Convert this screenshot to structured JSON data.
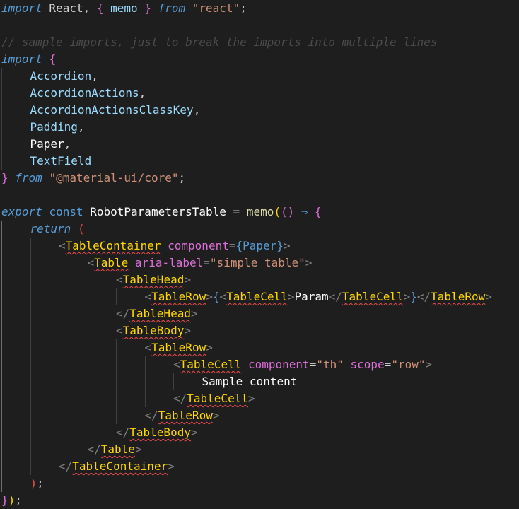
{
  "colors": {
    "background": "#1e1e1e",
    "keyword": "#569cd6",
    "keyword_control": "#c586c0",
    "identifier": "#9cdcfe",
    "plain": "#d4d4d4",
    "string": "#ce9178",
    "comment": "#6a9955",
    "tag": "#4ec9b0",
    "function": "#dcdcaa",
    "brace_gold": "#ffd700",
    "brace_pink": "#da70d6",
    "brace_blue": "#179fff",
    "bracket_tag": "#808080",
    "error_underline": "#f14c4c"
  },
  "code_lines": [
    {
      "indent": 0,
      "tokens": [
        {
          "t": "import",
          "c": "#569cd6",
          "i": true
        },
        {
          "t": " React, ",
          "c": "#d4d4d4"
        },
        {
          "t": "{",
          "c": "#da70d6"
        },
        {
          "t": " memo ",
          "c": "#9cdcfe"
        },
        {
          "t": "}",
          "c": "#da70d6"
        },
        {
          "t": " ",
          "c": "#d4d4d4"
        },
        {
          "t": "from",
          "c": "#569cd6",
          "i": true
        },
        {
          "t": " ",
          "c": "#d4d4d4"
        },
        {
          "t": "\"react\"",
          "c": "#ce9178"
        },
        {
          "t": ";",
          "c": "#d4d4d4"
        }
      ]
    },
    {
      "indent": 0,
      "tokens": []
    },
    {
      "indent": 0,
      "tokens": [
        {
          "t": "// sample imports, just to break the imports into multiple lines",
          "c": "#4b4b4b",
          "i": true
        }
      ]
    },
    {
      "indent": 0,
      "tokens": [
        {
          "t": "import",
          "c": "#569cd6",
          "i": true
        },
        {
          "t": " ",
          "c": "#d4d4d4"
        },
        {
          "t": "{",
          "c": "#da70d6"
        }
      ]
    },
    {
      "indent": 1,
      "tokens": [
        {
          "t": "Accordion",
          "c": "#9cdcfe"
        },
        {
          "t": ",",
          "c": "#d4d4d4"
        }
      ]
    },
    {
      "indent": 1,
      "tokens": [
        {
          "t": "AccordionActions",
          "c": "#9cdcfe"
        },
        {
          "t": ",",
          "c": "#d4d4d4"
        }
      ]
    },
    {
      "indent": 1,
      "tokens": [
        {
          "t": "AccordionActionsClassKey",
          "c": "#9cdcfe"
        },
        {
          "t": ",",
          "c": "#d4d4d4"
        }
      ]
    },
    {
      "indent": 1,
      "tokens": [
        {
          "t": "Padding",
          "c": "#9cdcfe"
        },
        {
          "t": ",",
          "c": "#d4d4d4"
        }
      ]
    },
    {
      "indent": 1,
      "tokens": [
        {
          "t": "Paper",
          "c": "#ffffff"
        },
        {
          "t": ",",
          "c": "#d4d4d4"
        }
      ]
    },
    {
      "indent": 1,
      "tokens": [
        {
          "t": "TextField",
          "c": "#9cdcfe"
        }
      ]
    },
    {
      "indent": 0,
      "tokens": [
        {
          "t": "}",
          "c": "#da70d6"
        },
        {
          "t": " ",
          "c": "#d4d4d4"
        },
        {
          "t": "from",
          "c": "#569cd6",
          "i": true
        },
        {
          "t": " ",
          "c": "#d4d4d4"
        },
        {
          "t": "\"@material-ui/core\"",
          "c": "#ce9178"
        },
        {
          "t": ";",
          "c": "#d4d4d4"
        }
      ]
    },
    {
      "indent": 0,
      "tokens": []
    },
    {
      "indent": 0,
      "tokens": [
        {
          "t": "export",
          "c": "#569cd6",
          "i": true
        },
        {
          "t": " ",
          "c": "#d4d4d4"
        },
        {
          "t": "const",
          "c": "#569cd6"
        },
        {
          "t": " RobotParametersTable ",
          "c": "#ffffff"
        },
        {
          "t": "=",
          "c": "#d4d4d4"
        },
        {
          "t": " ",
          "c": "#d4d4d4"
        },
        {
          "t": "memo",
          "c": "#dcdcaa"
        },
        {
          "t": "(",
          "c": "#ffd700"
        },
        {
          "t": "()",
          "c": "#da70d6"
        },
        {
          "t": " ",
          "c": "#d4d4d4"
        },
        {
          "t": "⇒",
          "c": "#569cd6"
        },
        {
          "t": " ",
          "c": "#d4d4d4"
        },
        {
          "t": "{",
          "c": "#da70d6"
        }
      ]
    },
    {
      "indent": 1,
      "tokens": [
        {
          "t": "return",
          "c": "#569cd6",
          "i": true
        },
        {
          "t": " ",
          "c": "#d4d4d4"
        },
        {
          "t": "(",
          "c": "#f14c4c"
        }
      ]
    },
    {
      "indent": 2,
      "tokens": [
        {
          "t": "<",
          "c": "#808080"
        },
        {
          "t": "TableContainer",
          "c": "#ffd700",
          "e": true
        },
        {
          "t": " ",
          "c": "#d4d4d4"
        },
        {
          "t": "component",
          "c": "#da70d6"
        },
        {
          "t": "=",
          "c": "#d4d4d4"
        },
        {
          "t": "{",
          "c": "#569cd6"
        },
        {
          "t": "Paper",
          "c": "#569cd6"
        },
        {
          "t": "}",
          "c": "#569cd6"
        },
        {
          "t": ">",
          "c": "#808080"
        }
      ]
    },
    {
      "indent": 3,
      "tokens": [
        {
          "t": "<",
          "c": "#808080"
        },
        {
          "t": "Table",
          "c": "#ffd700",
          "e": true
        },
        {
          "t": " ",
          "c": "#d4d4d4"
        },
        {
          "t": "aria-label",
          "c": "#da70d6"
        },
        {
          "t": "=",
          "c": "#d4d4d4"
        },
        {
          "t": "\"simple table\"",
          "c": "#ce9178"
        },
        {
          "t": ">",
          "c": "#808080"
        }
      ]
    },
    {
      "indent": 4,
      "tokens": [
        {
          "t": "<",
          "c": "#808080"
        },
        {
          "t": "TableHead",
          "c": "#ffd700",
          "e": true
        },
        {
          "t": ">",
          "c": "#808080"
        }
      ]
    },
    {
      "indent": 5,
      "tokens": [
        {
          "t": "<",
          "c": "#808080"
        },
        {
          "t": "TableRow",
          "c": "#ffd700",
          "e": true
        },
        {
          "t": ">",
          "c": "#808080"
        },
        {
          "t": "{",
          "c": "#569cd6"
        },
        {
          "t": "<",
          "c": "#808080"
        },
        {
          "t": "TableCell",
          "c": "#ffd700",
          "e": true
        },
        {
          "t": ">",
          "c": "#808080"
        },
        {
          "t": "Param",
          "c": "#ffffff"
        },
        {
          "t": "</",
          "c": "#808080"
        },
        {
          "t": "TableCell",
          "c": "#ffd700",
          "e": true
        },
        {
          "t": ">",
          "c": "#808080"
        },
        {
          "t": "}",
          "c": "#569cd6"
        },
        {
          "t": "</",
          "c": "#808080"
        },
        {
          "t": "TableRow",
          "c": "#ffd700",
          "e": true
        },
        {
          "t": ">",
          "c": "#808080"
        }
      ]
    },
    {
      "indent": 4,
      "tokens": [
        {
          "t": "</",
          "c": "#808080"
        },
        {
          "t": "TableHead",
          "c": "#ffd700",
          "e": true
        },
        {
          "t": ">",
          "c": "#808080"
        }
      ]
    },
    {
      "indent": 4,
      "tokens": [
        {
          "t": "<",
          "c": "#808080"
        },
        {
          "t": "TableBody",
          "c": "#ffd700",
          "e": true
        },
        {
          "t": ">",
          "c": "#808080"
        }
      ]
    },
    {
      "indent": 5,
      "tokens": [
        {
          "t": "<",
          "c": "#808080"
        },
        {
          "t": "TableRow",
          "c": "#ffd700",
          "e": true
        },
        {
          "t": ">",
          "c": "#808080"
        }
      ]
    },
    {
      "indent": 6,
      "tokens": [
        {
          "t": "<",
          "c": "#808080"
        },
        {
          "t": "TableCell",
          "c": "#ffd700",
          "e": true
        },
        {
          "t": " ",
          "c": "#d4d4d4"
        },
        {
          "t": "component",
          "c": "#da70d6"
        },
        {
          "t": "=",
          "c": "#d4d4d4"
        },
        {
          "t": "\"th\"",
          "c": "#ce9178"
        },
        {
          "t": " ",
          "c": "#d4d4d4"
        },
        {
          "t": "scope",
          "c": "#da70d6"
        },
        {
          "t": "=",
          "c": "#d4d4d4"
        },
        {
          "t": "\"row\"",
          "c": "#ce9178"
        },
        {
          "t": ">",
          "c": "#808080"
        }
      ]
    },
    {
      "indent": 7,
      "tokens": [
        {
          "t": "Sample content",
          "c": "#ffffff"
        }
      ]
    },
    {
      "indent": 6,
      "tokens": [
        {
          "t": "</",
          "c": "#808080"
        },
        {
          "t": "TableCell",
          "c": "#ffd700",
          "e": true
        },
        {
          "t": ">",
          "c": "#808080"
        }
      ]
    },
    {
      "indent": 5,
      "tokens": [
        {
          "t": "</",
          "c": "#808080"
        },
        {
          "t": "TableRow",
          "c": "#ffd700",
          "e": true
        },
        {
          "t": ">",
          "c": "#808080"
        }
      ]
    },
    {
      "indent": 4,
      "tokens": [
        {
          "t": "</",
          "c": "#808080"
        },
        {
          "t": "TableBody",
          "c": "#ffd700",
          "e": true
        },
        {
          "t": ">",
          "c": "#808080"
        }
      ]
    },
    {
      "indent": 3,
      "tokens": [
        {
          "t": "</",
          "c": "#808080"
        },
        {
          "t": "Table",
          "c": "#ffd700",
          "e": true
        },
        {
          "t": ">",
          "c": "#808080"
        }
      ]
    },
    {
      "indent": 2,
      "tokens": [
        {
          "t": "</",
          "c": "#808080"
        },
        {
          "t": "TableContainer",
          "c": "#ffd700",
          "e": true
        },
        {
          "t": ">",
          "c": "#808080"
        }
      ]
    },
    {
      "indent": 1,
      "tokens": [
        {
          "t": ")",
          "c": "#f14c4c"
        },
        {
          "t": ";",
          "c": "#d4d4d4"
        }
      ]
    },
    {
      "indent": 0,
      "tokens": [
        {
          "t": "}",
          "c": "#da70d6"
        },
        {
          "t": ")",
          "c": "#ffd700"
        },
        {
          "t": ";",
          "c": "#d4d4d4"
        }
      ]
    }
  ]
}
